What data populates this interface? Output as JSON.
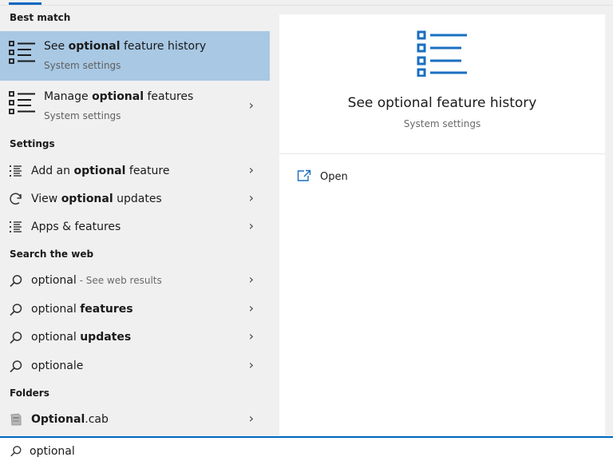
{
  "best_match": {
    "header": "Best match",
    "items": [
      {
        "title_pre": "See ",
        "title_bold": "optional",
        "title_post": " feature history",
        "subtitle": "System settings",
        "selected": true,
        "icon": "list-settings-icon"
      },
      {
        "title_pre": "Manage ",
        "title_bold": "optional",
        "title_post": " features",
        "subtitle": "System settings",
        "selected": false,
        "icon": "list-settings-icon"
      }
    ]
  },
  "settings": {
    "header": "Settings",
    "items": [
      {
        "pre": "Add an ",
        "bold": "optional",
        "post": " feature",
        "icon": "list-icon"
      },
      {
        "pre": "View ",
        "bold": "optional",
        "post": " updates",
        "icon": "refresh-icon"
      },
      {
        "pre": "Apps & features",
        "bold": "",
        "post": "",
        "icon": "list-icon"
      }
    ]
  },
  "web": {
    "header": "Search the web",
    "items": [
      {
        "pre": "optional",
        "bold": "",
        "post": "",
        "suffix": " - See web results",
        "icon": "search-icon"
      },
      {
        "pre": "optional ",
        "bold": "features",
        "post": "",
        "suffix": "",
        "icon": "search-icon"
      },
      {
        "pre": "optional ",
        "bold": "updates",
        "post": "",
        "suffix": "",
        "icon": "search-icon"
      },
      {
        "pre": "optionale",
        "bold": "",
        "post": "",
        "suffix": "",
        "icon": "search-icon"
      }
    ]
  },
  "folders": {
    "header": "Folders",
    "items": [
      {
        "bold": "Optional",
        "post": ".cab",
        "icon": "cab-file-icon"
      }
    ]
  },
  "preview": {
    "title": "See optional feature history",
    "subtitle": "System settings",
    "actions": [
      {
        "label": "Open",
        "icon": "open-icon"
      }
    ]
  },
  "search": {
    "value": "optional",
    "icon": "search-icon"
  },
  "colors": {
    "accent": "#0067c0",
    "selected": "#a8c8e4",
    "icon_blue": "#1a6fc0"
  }
}
